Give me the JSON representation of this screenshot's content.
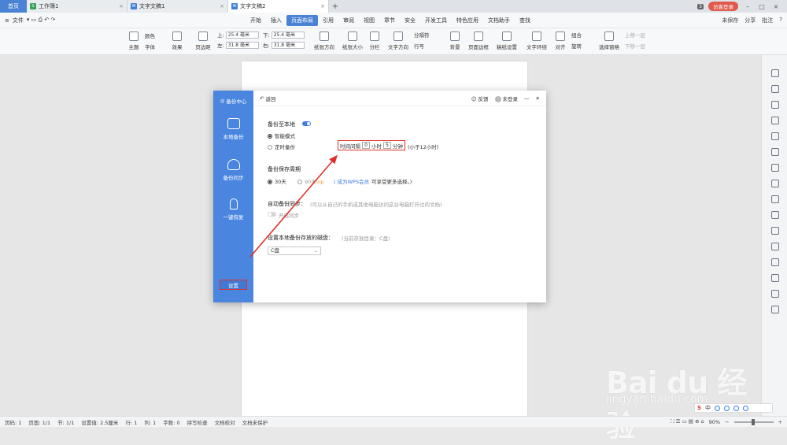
{
  "tabs": {
    "home": "首页",
    "docs": [
      {
        "label": "工作簿1",
        "icon": "S"
      },
      {
        "label": "文字文稿1",
        "icon": "W"
      },
      {
        "label": "文字文稿2",
        "icon": "W"
      }
    ],
    "badge": "3",
    "login": "访客登录"
  },
  "menu": {
    "file": "文件",
    "tabs": [
      "开始",
      "插入",
      "页面布局",
      "引用",
      "审阅",
      "视图",
      "章节",
      "安全",
      "开发工具",
      "特色应用",
      "文档助手",
      "查找"
    ],
    "active": "页面布局",
    "right": [
      "未保存",
      "分享",
      "批注"
    ]
  },
  "ribbon": {
    "theme": "主题",
    "color": "颜色",
    "font": "字体",
    "effect": "效果",
    "margin": "页边距",
    "top_label": "上:",
    "top_value": "25.4 毫米",
    "bottom_label": "下:",
    "bottom_value": "25.4 毫米",
    "left_label": "左:",
    "left_value": "31.8 毫米",
    "right_label": "右:",
    "right_value": "31.8 毫米",
    "orientation": "纸张方向",
    "size": "纸张大小",
    "columns": "分栏",
    "direction": "文字方向",
    "separator": "分隔符",
    "line_number": "行号",
    "background": "背景",
    "border": "页面边框",
    "paper_setting": "稿纸设置",
    "wrap": "文字环绕",
    "align": "对齐",
    "group": "组合",
    "rotate": "旋转",
    "select_pane": "选择窗格",
    "up": "上移一层",
    "down": "下移一层"
  },
  "dialog": {
    "title": "备份中心",
    "back": "返回",
    "feedback": "反馈",
    "not_logged": "未登录",
    "side": [
      "本地备份",
      "备份同步",
      "一键恢复"
    ],
    "settings": "设置",
    "backup_local": "备份至本地",
    "smart_mode": "智能模式",
    "timed_backup": "定时备份",
    "interval_label": "时间间隔",
    "hours_value": "0",
    "hours_unit": "小时",
    "minutes_value": "5",
    "minutes_unit": "分钟",
    "interval_note": "(小于12小时)",
    "retention_title": "备份保存周期",
    "days30": "30天",
    "days90": "90天",
    "vip_tag": "vip",
    "become_member": "( 成为WPS会员",
    "member_note": "可享受更多选择。)",
    "auto_sync_title": "自动备份同步：",
    "auto_sync_note": "(可以从自己的手机或其他电脑访问这台电脑打开过的文档)",
    "enable_sync": "开启同步",
    "disk_title": "设置本地备份存放的磁盘：",
    "disk_note": "(当前存放目录：C盘)",
    "disk_value": "C盘"
  },
  "status": {
    "page_code": "页码: 1",
    "page": "页面: 1/1",
    "section": "节: 1/1",
    "setting": "设置值: 2.5厘米",
    "row": "行: 1",
    "col": "列: 1",
    "words": "字数: 0",
    "spell": "拼写检查",
    "proof": "文档校对",
    "protect": "文档未保护",
    "zoom": "90%"
  },
  "watermark": {
    "logo": "Bai du 经验",
    "url": "jingyan.baidu.com"
  }
}
